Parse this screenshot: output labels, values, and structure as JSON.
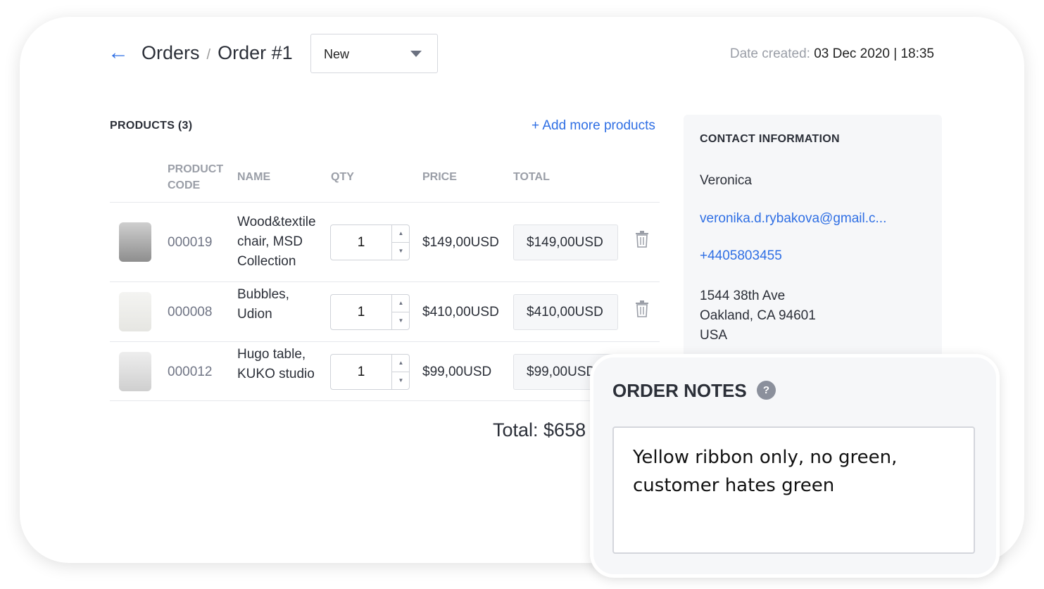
{
  "header": {
    "back_icon": "arrow-left-icon",
    "breadcrumb_root": "Orders",
    "breadcrumb_sep": "/",
    "breadcrumb_current": "Order #1",
    "status_value": "New",
    "date_label": "Date created:",
    "date_value": "03 Dec 2020 | 18:35"
  },
  "products": {
    "title": "PRODUCTS (3)",
    "add_more": "+ Add more products",
    "columns": {
      "code_line1": "PRODUCT",
      "code_line2": "CODE",
      "name": "NAME",
      "qty": "QTY",
      "price": "PRICE",
      "total": "TOTAL"
    },
    "rows": [
      {
        "code": "000019",
        "name": "Wood&textile chair, MSD Collection",
        "qty": "1",
        "price": "$149,00USD",
        "total": "$149,00USD"
      },
      {
        "code": "000008",
        "name": "Bubbles, Udion",
        "qty": "1",
        "price": "$410,00USD",
        "total": "$410,00USD"
      },
      {
        "code": "000012",
        "name": "Hugo table, KUKO studio",
        "qty": "1",
        "price": "$99,00USD",
        "total": "$99,00USD"
      }
    ],
    "grand_total": "Total: $658"
  },
  "contact": {
    "title": "CONTACT INFORMATION",
    "name": "Veronica",
    "email": "veronika.d.rybakova@gmail.c...",
    "phone": "+4405803455",
    "address_line1": "1544 38th Ave",
    "address_line2": "Oakland, CA 94601",
    "address_line3": "USA"
  },
  "notes": {
    "title": "ORDER NOTES",
    "help": "?",
    "text": "Yellow ribbon only, no green, customer hates green"
  },
  "colors": {
    "accent": "#2f6fe4",
    "panel": "#f6f7f9"
  }
}
